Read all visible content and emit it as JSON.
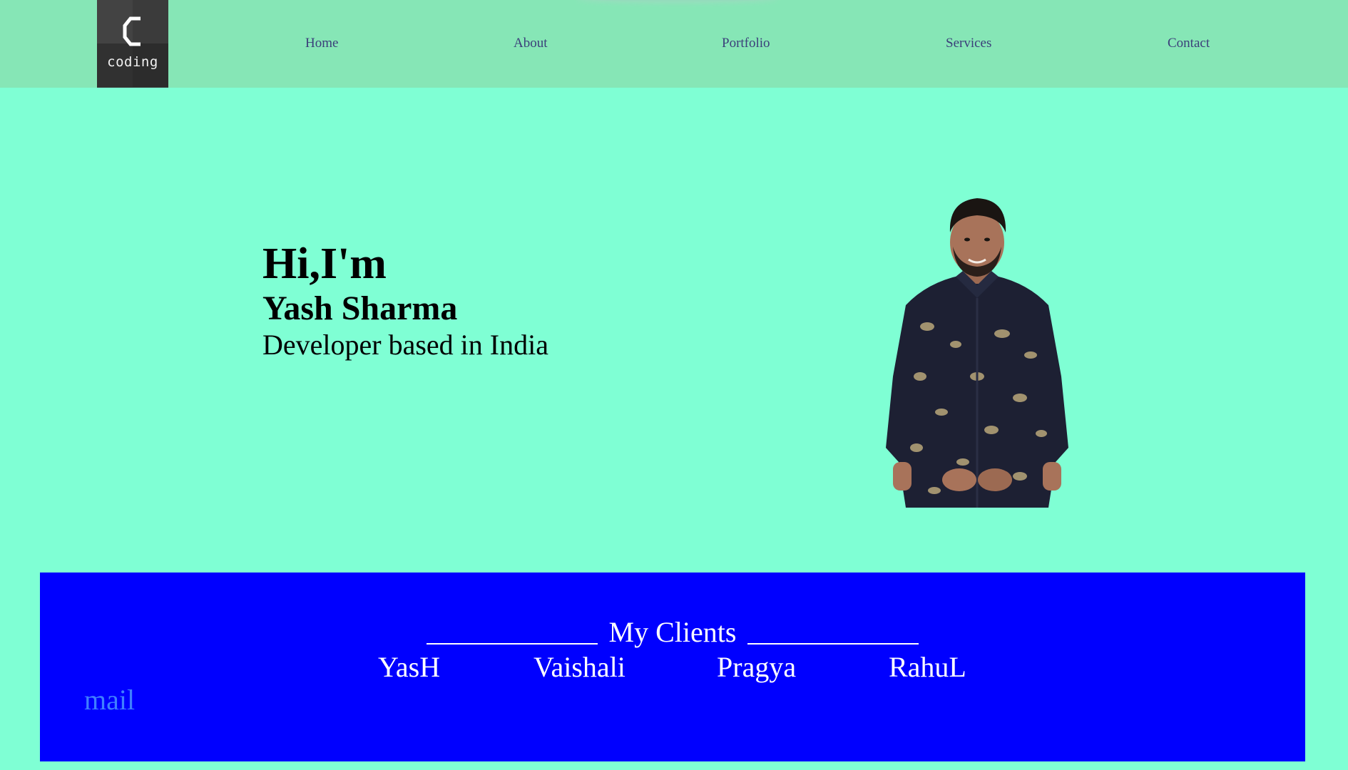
{
  "header": {
    "logo": {
      "mark": "C",
      "text": "coding"
    },
    "nav": [
      {
        "label": "Home"
      },
      {
        "label": "About"
      },
      {
        "label": "Portfolio"
      },
      {
        "label": "Services"
      },
      {
        "label": "Contact"
      }
    ]
  },
  "hero": {
    "greeting": "Hi,I'm",
    "name": "Yash Sharma",
    "tagline": "Developer based in India",
    "portrait_icon": "person-photo-icon"
  },
  "clients": {
    "heading": "My Clients",
    "names": [
      "YasH",
      "Vaishali",
      "Pragya",
      "RahuL"
    ],
    "mail_label": "mail"
  },
  "colors": {
    "page_background": "#7fffd4",
    "header_background": "#86e6b6",
    "nav_text": "#3b3f7a",
    "clients_background": "#0000ff",
    "mail_link": "#3f7fff"
  }
}
